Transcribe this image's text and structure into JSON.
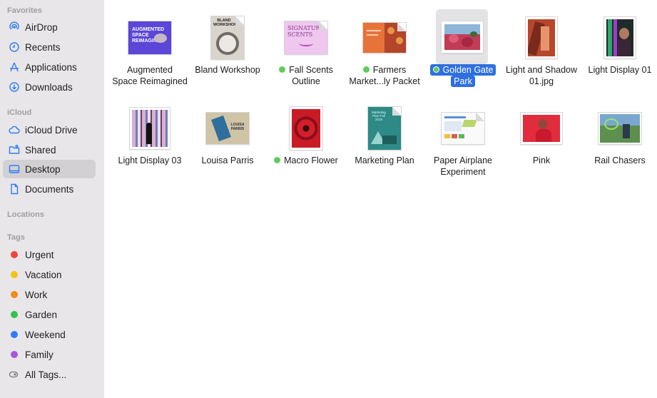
{
  "sidebar": {
    "favorites_header": "Favorites",
    "favorites": [
      {
        "label": "AirDrop",
        "icon": "airdrop-icon"
      },
      {
        "label": "Recents",
        "icon": "clock-icon"
      },
      {
        "label": "Applications",
        "icon": "applications-icon"
      },
      {
        "label": "Downloads",
        "icon": "download-icon"
      }
    ],
    "icloud_header": "iCloud",
    "icloud": [
      {
        "label": "iCloud Drive",
        "icon": "cloud-icon"
      },
      {
        "label": "Shared",
        "icon": "shared-folder-icon"
      },
      {
        "label": "Desktop",
        "icon": "desktop-icon",
        "selected": true
      },
      {
        "label": "Documents",
        "icon": "document-icon"
      }
    ],
    "locations_header": "Locations",
    "tags_header": "Tags",
    "tags": [
      {
        "label": "Urgent",
        "color": "#f0443a"
      },
      {
        "label": "Vacation",
        "color": "#f5c218"
      },
      {
        "label": "Work",
        "color": "#f08a1c"
      },
      {
        "label": "Garden",
        "color": "#36c24b"
      },
      {
        "label": "Weekend",
        "color": "#2f7cf6"
      },
      {
        "label": "Family",
        "color": "#a857d8"
      }
    ],
    "all_tags_label": "All Tags..."
  },
  "files": [
    {
      "line1": "Augmented",
      "line2": "Space Reimagined",
      "tag": false,
      "thumb_text": "AUGMENTED SPACE REIMAGINED"
    },
    {
      "line1": "Bland Workshop",
      "line2": "",
      "tag": false,
      "thumb_text": "BLAND WORKSHOP"
    },
    {
      "line1": "Fall Scents",
      "line2": "Outline",
      "tag": true,
      "thumb_text": "SIGNATURE SCENTS"
    },
    {
      "line1": "Farmers",
      "line2": "Market...ly Packet",
      "tag": true
    },
    {
      "line1": "Golden Gate",
      "line2": "Park",
      "tag": true,
      "selected": true
    },
    {
      "line1": "Light and Shadow",
      "line2": "01.jpg",
      "tag": false
    },
    {
      "line1": "Light Display 01",
      "line2": "",
      "tag": false
    },
    {
      "line1": "Light Display 03",
      "line2": "",
      "tag": false
    },
    {
      "line1": "Louisa Parris",
      "line2": "",
      "tag": false,
      "thumb_text": "LOUISA PARRIS"
    },
    {
      "line1": "Macro Flower",
      "line2": "",
      "tag": true
    },
    {
      "line1": "Marketing Plan",
      "line2": "",
      "tag": false,
      "thumb_text": "Marketing Plan Fall 2019"
    },
    {
      "line1": "Paper Airplane",
      "line2": "Experiment",
      "tag": false
    },
    {
      "line1": "Pink",
      "line2": "",
      "tag": false
    },
    {
      "line1": "Rail Chasers",
      "line2": "",
      "tag": false
    }
  ],
  "colors": {
    "accent": "#2f6fe0",
    "sidebar_bg": "#e8e6e8",
    "tag_green": "#5fcc5e"
  }
}
